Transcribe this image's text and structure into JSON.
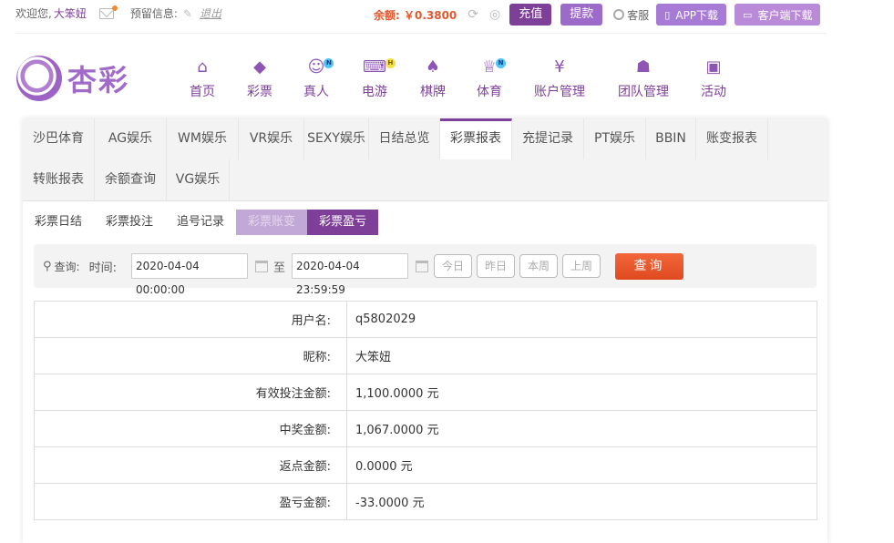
{
  "topbar": {
    "welcome": "欢迎您,",
    "username": "大笨妞",
    "reserve_label": "预留信息:",
    "logout": "退出",
    "balance": "余额: ￥0.3800",
    "recharge": "充值",
    "withdraw": "提款",
    "service": "客服",
    "app_download": "APP下载",
    "pc_download": "客户端下载"
  },
  "logo": {
    "text": "杏彩"
  },
  "nav": [
    {
      "label": "首页",
      "icon": "home-icon"
    },
    {
      "label": "彩票",
      "icon": "lottery-icon"
    },
    {
      "label": "真人",
      "icon": "live-dealer-icon",
      "badge": "N"
    },
    {
      "label": "电游",
      "icon": "gamepad-icon",
      "badge": "H"
    },
    {
      "label": "棋牌",
      "icon": "cards-icon"
    },
    {
      "label": "体育",
      "icon": "trophy-icon",
      "badge": "N"
    },
    {
      "label": "账户管理",
      "icon": "account-icon"
    },
    {
      "label": "团队管理",
      "icon": "team-icon"
    },
    {
      "label": "活动",
      "icon": "gift-icon"
    }
  ],
  "tabs": [
    "沙巴体育",
    "AG娱乐",
    "WM娱乐",
    "VR娱乐",
    "SEXY娱乐",
    "日结总览",
    "彩票报表",
    "充提记录",
    "PT娱乐",
    "BBIN",
    "账变报表",
    "转账报表",
    "余额查询",
    "VG娱乐"
  ],
  "active_tab": "彩票报表",
  "subtabs": [
    "彩票日结",
    "彩票投注",
    "追号记录",
    "彩票账变",
    "彩票盈亏"
  ],
  "query": {
    "label": "查询:",
    "time_label": "时间:",
    "start": "2020-04-04 00:00:00",
    "to": "至",
    "end": "2020-04-04 23:59:59",
    "today": "今日",
    "yesterday": "昨日",
    "this_week": "本周",
    "last_week": "上周",
    "submit": "查询"
  },
  "result": [
    {
      "key": "用户名:",
      "value": "q5802029"
    },
    {
      "key": "昵称:",
      "value": "大笨妞"
    },
    {
      "key": "有效投注金额:",
      "value": "1,100.0000 元"
    },
    {
      "key": "中奖金额:",
      "value": "1,067.0000 元"
    },
    {
      "key": "返点金额:",
      "value": "0.0000 元"
    },
    {
      "key": "盈亏金额:",
      "value": "-33.0000 元"
    }
  ]
}
